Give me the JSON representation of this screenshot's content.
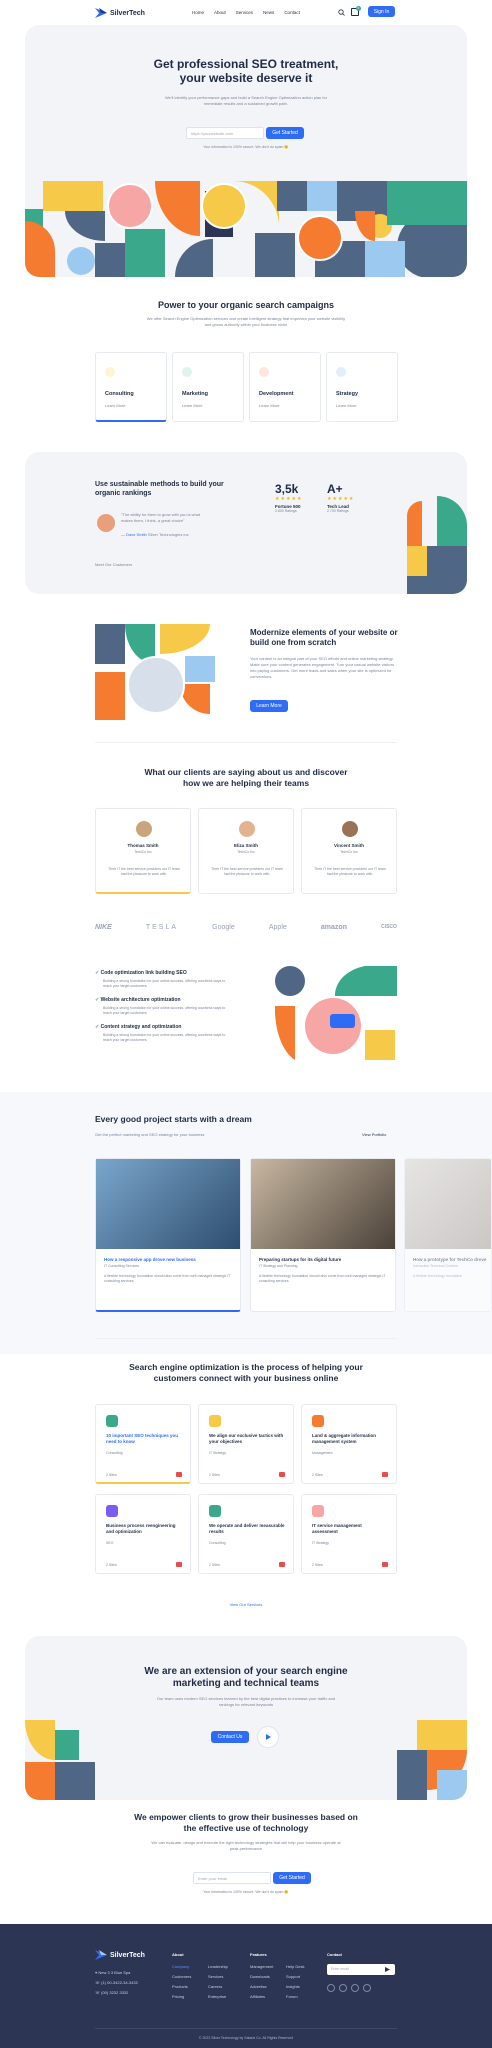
{
  "nav": {
    "brand": "SilverTech",
    "items": [
      "Home",
      "About",
      "Services",
      "News",
      "Contact"
    ],
    "signin": "Sign In",
    "cart_count": "0"
  },
  "hero": {
    "title1": "Get professional SEO treatment,",
    "title2": "your website deserve it",
    "desc": "We'll identify your performance gaps and build a Search Engine Optimization action plan for immediate results and a sustained growth path.",
    "placeholder": "https://yourwebsite.com",
    "cta": "Get Started",
    "note": "Your information is 100% secure. We don't do spam 🙂"
  },
  "campaigns": {
    "title": "Power to your organic search campaigns",
    "desc": "We offer Search Engine Optimization services and create intelligent strategy that improves your website visibility and grows authority within your business niche",
    "cards": [
      {
        "label": "Consulting",
        "link": "Learn More"
      },
      {
        "label": "Marketing",
        "link": "Learn More"
      },
      {
        "label": "Development",
        "link": "Learn More"
      },
      {
        "label": "Strategy",
        "link": "Learn More"
      }
    ]
  },
  "methods": {
    "title": "Use sustainable methods to build your organic rankings",
    "quote": "\"The ability for them to grow with you is what makes them, I think, a great choice\"",
    "author": "— Dave Smith",
    "company": "Silver Technologies Inc",
    "stat1": "3,5k",
    "stat1_label": "Fortune 500",
    "stat1_sub": "2,800 Ratings",
    "stat2": "A+",
    "stat2_label": "Tech Lead",
    "stat2_sub": "2,700 Ratings",
    "customers_link": "Meet Our Customers"
  },
  "modernize": {
    "title": "Modernize elements of your website or build one from scratch",
    "desc": "Your content is an integral part of your SEO efforts and online marketing strategy. Make sure your content generates engagement. Turn your casual website visitors into paying customers. Get more leads and sales when your site is optimized for conversions.",
    "cta": "Learn More"
  },
  "testimonials": {
    "title1": "What our clients are saying about us and discover",
    "title2": "how we are helping their teams",
    "people": [
      {
        "name": "Thomas Smith",
        "company": "TechCo Inc",
        "text": "Their IT the best service providers our IT team had the pleasure to work with."
      },
      {
        "name": "Eliza Smith",
        "company": "TechCo Inc",
        "text": "Their IT the best service providers our IT team had the pleasure to work with."
      },
      {
        "name": "Vincent Smith",
        "company": "TechCo Inc",
        "text": "Their IT the best service providers our IT team had the pleasure to work with."
      }
    ]
  },
  "logos": [
    "NIKE",
    "TESLA",
    "Google",
    "Apple",
    "amazon",
    "CISCO"
  ],
  "features": [
    {
      "title": "Code optimization link building SEO",
      "desc": "Building a strong foundation for your online success, offering countless ways to reach your target customers"
    },
    {
      "title": "Website architecture optimization",
      "desc": "Building a strong foundation for your online success, offering countless ways to reach your target customers"
    },
    {
      "title": "Content strategy and optimization",
      "desc": "Building a strong foundation for your online success, offering countless ways to reach your target customers"
    }
  ],
  "projects": {
    "title": "Every good project starts with a dream",
    "sub": "Get the perfect marketing and SEO strategy for your business",
    "link": "View Portfolio",
    "items": [
      {
        "title": "How a responsive app drove new business",
        "cat": "IT Consulting Services",
        "desc": "A flexible technology foundation should also come from well-managed strategic IT consulting services"
      },
      {
        "title": "Preparing startups for its digital future",
        "cat": "IT Strategy and Planning",
        "desc": "A flexible technology foundation should also come from well-managed strategic IT consulting services"
      },
      {
        "title": "How a prototype for TechCo drove",
        "cat": "Interactive Technical Content",
        "desc": "A flexible technology foundation"
      }
    ]
  },
  "process": {
    "title1": "Search engine optimization is the process of helping your",
    "title2": "customers connect with your business online",
    "cards": [
      {
        "title": "10 important SEO techniques you need to know",
        "cat": "Consulting",
        "meta": "2 Sites"
      },
      {
        "title": "We align our exclusive tactics with your objectives",
        "cat": "IT Strategy",
        "meta": "2 Sites"
      },
      {
        "title": "Land & aggregate information management system",
        "cat": "Management",
        "meta": "2 Sites"
      },
      {
        "title": "Business process reengineering and optimization",
        "cat": "SEO",
        "meta": "2 Sites"
      },
      {
        "title": "We operate and deliver measurable results",
        "cat": "Consulting",
        "meta": "2 Sites"
      },
      {
        "title": "IT service management assessment",
        "cat": "IT Strategy",
        "meta": "2 Sites"
      }
    ],
    "link": "View Our Services"
  },
  "extension": {
    "title1": "We are an extension of your search engine",
    "title2": "marketing and technical teams",
    "desc": "Our team uses modern SEO services learned by the best digital practices to increase your traffic and rankings for relevant keywords",
    "cta": "Contact Us"
  },
  "empower": {
    "title1": "We empower clients to grow their businesses based on",
    "title2": "the effective use of technology",
    "desc": "We can evaluate, design and execute the right technology strategies that will help your business operate at peak performance",
    "placeholder": "Enter your email",
    "cta": "Get Started",
    "note": "Your information is 100% secure. We don't do spam 🙂"
  },
  "footer": {
    "brand": "SilverTech",
    "address": "New 3 3 Blue Spa",
    "phone1": "(1) 00-3422-34-3432",
    "phone2": "(00) 3232 3332",
    "cols": [
      {
        "head": "About",
        "items": [
          "Company",
          "Customers",
          "Products",
          "Pricing"
        ]
      },
      {
        "head": "",
        "items": [
          "Leadership",
          "Services",
          "Careers",
          "Enterprise"
        ]
      },
      {
        "head": "Features",
        "items": [
          "Management",
          "Downloads",
          "Advertise",
          "Affiliates"
        ]
      },
      {
        "head": "",
        "items": [
          "Help Desk",
          "Support",
          "Insights",
          "Forum"
        ]
      }
    ],
    "contact_head": "Contact",
    "email_placeholder": "Enter email",
    "copyright": "© 2022 Silver Technology by Sataris Co. All Rights Reserved"
  },
  "colors": {
    "accent": "#2f6cf6",
    "navy": "#2c3654",
    "orange": "#f47b30",
    "yellow": "#f7c948",
    "teal": "#3aa98b",
    "slate": "#4f6785",
    "pink": "#f7a6a6",
    "lightblue": "#9cc9f0"
  }
}
